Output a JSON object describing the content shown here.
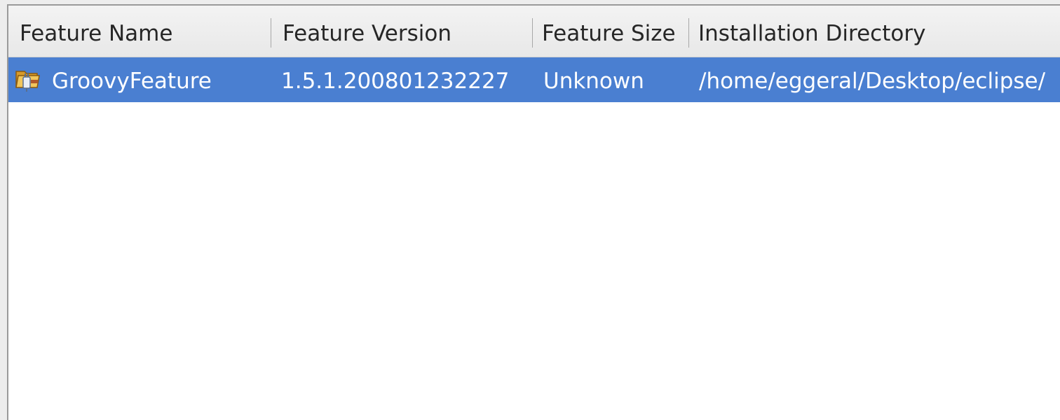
{
  "table": {
    "columns": [
      {
        "label": "Feature Name"
      },
      {
        "label": "Feature Version"
      },
      {
        "label": "Feature Size"
      },
      {
        "label": "Installation Directory"
      }
    ],
    "rows": [
      {
        "icon": "feature-icon",
        "selected": true,
        "cells": [
          "GroovyFeature",
          "1.5.1.200801232227",
          "Unknown",
          "/home/eggeral/Desktop/eclipse/"
        ]
      }
    ]
  },
  "colors": {
    "selection": "#4a7fd1",
    "header_bg": "#ededed",
    "selected_text": "#ffffff"
  }
}
